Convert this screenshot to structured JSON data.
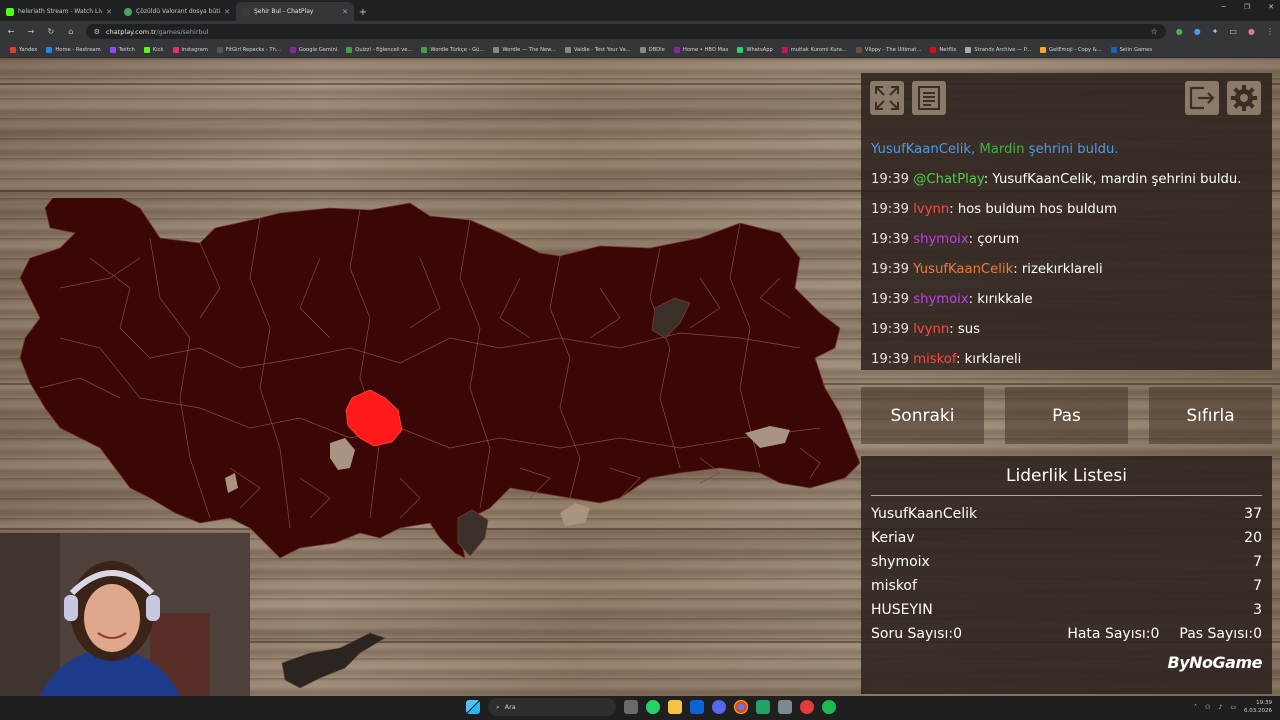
{
  "browser": {
    "tabs": [
      {
        "title": "heleriath Stream - Watch Live o",
        "color": "#53fc18"
      },
      {
        "title": "Çözüldü Valorant dosya bütünl",
        "color": "#4aa564"
      },
      {
        "title": "Şehir Bul - ChatPlay",
        "color": "#3c3c3c"
      }
    ],
    "url_host": "chatplay.com.tr",
    "url_path": "/games/sehirbul",
    "bookmarks": [
      "Yandex",
      "Home - Restream",
      "Twitch",
      "Kick",
      "Instagram",
      "FitGirl Repacks - Th...",
      "Google Gemini",
      "Quizzi - Eğlenceli ve...",
      "Wordle Türkçe - Gü...",
      "Wordle — The New...",
      "Valdle - Test Your Va...",
      "DBDle",
      "Home • HBO Max",
      "WhatsApp",
      "mutlak Kuromi Kura...",
      "Vlippy - The Ultimat...",
      "Netflix",
      "Strands Archive — P...",
      "GetEmoji - Copy &...",
      "Selin Games"
    ]
  },
  "chat": {
    "system": {
      "user": "YusufKaanCelik,",
      "city": "Mardin",
      "msg": "şehrini buldu."
    },
    "messages": [
      {
        "time": "19:39",
        "user": "@ChatPlay",
        "color": "#4ad04a",
        "text": ": YusufKaanCelik, mardin şehrini buldu."
      },
      {
        "time": "19:39",
        "user": "lvynn",
        "color": "#ff4646",
        "text": ": hos buldum hos buldum"
      },
      {
        "time": "19:39",
        "user": "shymoix",
        "color": "#c040e8",
        "text": ": çorum"
      },
      {
        "time": "19:39",
        "user": "YusufKaanCelik",
        "color": "#f07a3c",
        "text": ": rizekırklareli"
      },
      {
        "time": "19:39",
        "user": "shymoix",
        "color": "#c040e8",
        "text": ": kırıkkale"
      },
      {
        "time": "19:39",
        "user": "lvynn",
        "color": "#ff4646",
        "text": ": sus"
      },
      {
        "time": "19:39",
        "user": "miskof",
        "color": "#ff4646",
        "text": ": kırklareli"
      }
    ]
  },
  "controls": {
    "next": "Sonraki",
    "pass": "Pas",
    "reset": "Sıfırla"
  },
  "leaderboard": {
    "title": "Liderlik Listesi",
    "rows": [
      {
        "name": "YusufKaanCelik",
        "score": "37"
      },
      {
        "name": "Keriav",
        "score": "20"
      },
      {
        "name": "shymoix",
        "score": "7"
      },
      {
        "name": "miskof",
        "score": "7"
      },
      {
        "name": "HUSEYIN",
        "score": "3"
      }
    ],
    "question_count": "Soru Sayısı:0",
    "error_count": "Hata Sayısı:0",
    "pass_count": "Pas Sayısı:0",
    "brand": "ByNoGame"
  },
  "taskbar": {
    "search": "Ara",
    "time": "19:39",
    "date": "6.03.2026"
  },
  "colors": {
    "map_fill": "#3a0606",
    "map_highlight": "#ff1a1a",
    "panel": "#2d231e"
  }
}
